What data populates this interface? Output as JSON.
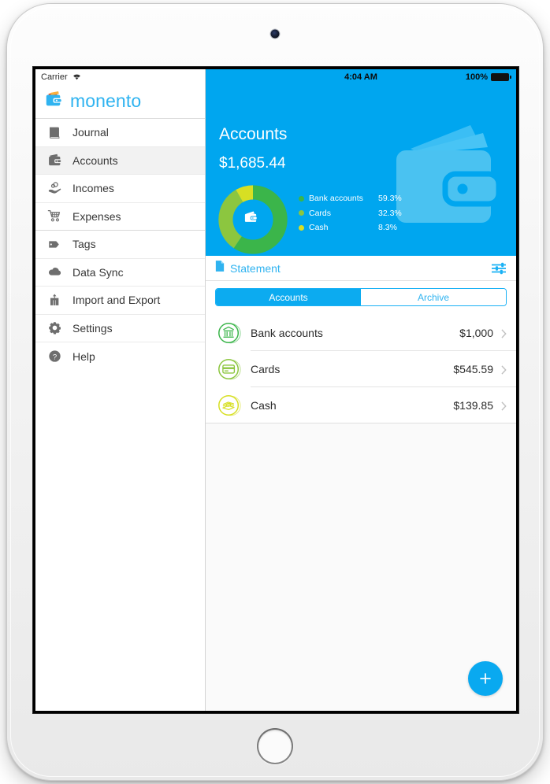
{
  "device": {
    "kind": "tablet"
  },
  "sidebar": {
    "status": {
      "carrier": "Carrier",
      "wifi_icon": "wifi-icon"
    },
    "brand": {
      "name": "monento",
      "logo_icon": "wallet-logo-icon"
    },
    "items": [
      {
        "label": "Journal",
        "icon": "book-icon",
        "selected": false
      },
      {
        "label": "Accounts",
        "icon": "wallet-icon",
        "selected": true
      },
      {
        "label": "Incomes",
        "icon": "hand-coins-icon",
        "selected": false
      },
      {
        "label": "Expenses",
        "icon": "shopping-cart-icon",
        "selected": false
      },
      {
        "label": "Tags",
        "icon": "tag-icon",
        "selected": false
      },
      {
        "label": "Data Sync",
        "icon": "cloud-icon",
        "selected": false
      },
      {
        "label": "Import and Export",
        "icon": "export-box-icon",
        "selected": false
      },
      {
        "label": "Settings",
        "icon": "gear-icon",
        "selected": false
      },
      {
        "label": "Help",
        "icon": "question-circle-icon",
        "selected": false
      }
    ]
  },
  "main": {
    "status": {
      "time": "4:04 AM",
      "battery_percent": "100%",
      "battery_icon": "battery-full-icon"
    },
    "hero": {
      "title": "Accounts",
      "total": "$1,685.44",
      "watermark_icon": "wallet-watermark-icon",
      "center_icon": "wallet-icon"
    },
    "statement": {
      "label": "Statement",
      "doc_icon": "document-icon",
      "filter_icon": "sliders-icon"
    },
    "segmented": {
      "options": [
        {
          "label": "Accounts",
          "active": true
        },
        {
          "label": "Archive",
          "active": false
        }
      ]
    },
    "accounts": [
      {
        "name": "Bank accounts",
        "amount": "$1,000",
        "icon": "bank-icon",
        "color": "#3bb54a",
        "chevron_icon": "chevron-right-icon"
      },
      {
        "name": "Cards",
        "amount": "$545.59",
        "icon": "credit-card-icon",
        "color": "#8cc63f",
        "chevron_icon": "chevron-right-icon"
      },
      {
        "name": "Cash",
        "amount": "$139.85",
        "icon": "cash-stack-icon",
        "color": "#d7df23",
        "chevron_icon": "chevron-right-icon"
      }
    ],
    "fab": {
      "label": "+",
      "icon": "plus-icon"
    }
  },
  "colors": {
    "accent_blue": "#00a6ef",
    "link_blue": "#2fb3f0",
    "bank_green": "#3bb54a",
    "cards_green": "#8cc63f",
    "cash_yellow": "#d7df23"
  },
  "chart_data": {
    "type": "pie",
    "title": "Accounts",
    "categories": [
      "Bank accounts",
      "Cards",
      "Cash"
    ],
    "values": [
      59.3,
      32.3,
      8.3
    ],
    "amounts": [
      "$1,000",
      "$545.59",
      "$139.85"
    ],
    "colors": [
      "#3bb54a",
      "#8cc63f",
      "#d7df23"
    ],
    "unit": "%",
    "total_label": "$1,685.44",
    "donut": true,
    "legend_position": "right"
  }
}
